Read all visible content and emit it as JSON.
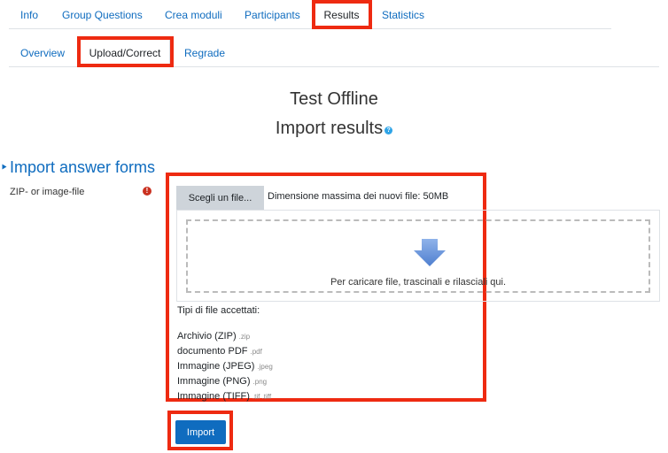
{
  "tabs_primary": [
    {
      "label": "Info"
    },
    {
      "label": "Group Questions"
    },
    {
      "label": "Crea moduli"
    },
    {
      "label": "Participants"
    },
    {
      "label": "Results",
      "active": true
    },
    {
      "label": "Statistics"
    }
  ],
  "tabs_secondary": [
    {
      "label": "Overview"
    },
    {
      "label": "Upload/Correct",
      "active": true
    },
    {
      "label": "Regrade"
    }
  ],
  "page": {
    "title": "Test Offline",
    "subtitle": "Import results",
    "help_icon_glyph": "?"
  },
  "section": {
    "legend": "Import answer forms"
  },
  "field": {
    "label": "ZIP- or image-file",
    "required_icon_glyph": "!",
    "choose_button": "Scegli un file...",
    "max_size": "Dimensione massima dei nuovi file: 50MB",
    "drop_text": "Per caricare file, trascinali e rilasciali qui.",
    "accepted_title": "Tipi di file accettati:",
    "accepted_types": [
      {
        "name": "Archivio (ZIP)",
        "ext": ".zip"
      },
      {
        "name": "documento PDF",
        "ext": ".pdf"
      },
      {
        "name": "Immagine (JPEG)",
        "ext": ".jpeg"
      },
      {
        "name": "Immagine (PNG)",
        "ext": ".png"
      },
      {
        "name": "Immagine (TIFF)",
        "ext": ".tif .tiff"
      }
    ]
  },
  "actions": {
    "import_label": "Import"
  },
  "colors": {
    "link": "#0f6cbf",
    "highlight": "#ee2a11",
    "drop_arrow": "#6d97d8"
  }
}
